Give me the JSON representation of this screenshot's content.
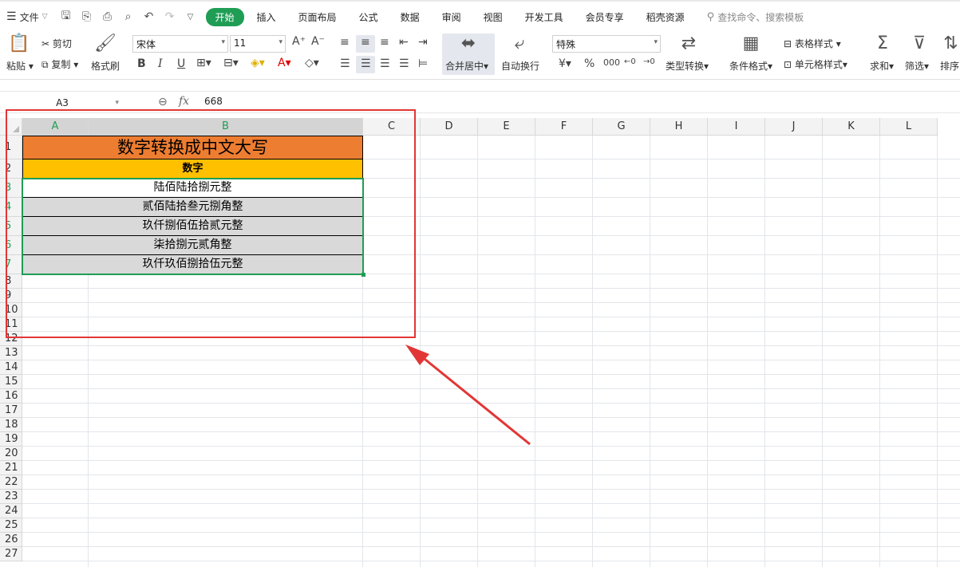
{
  "menubar": {
    "file_label": "文件",
    "tabs": [
      "开始",
      "插入",
      "页面布局",
      "公式",
      "数据",
      "审阅",
      "视图",
      "开发工具",
      "会员专享",
      "稻壳资源"
    ],
    "active_tab": "开始",
    "search_placeholder": "查找命令、搜索模板"
  },
  "ribbon": {
    "paste": "粘贴",
    "cut": "剪切",
    "copy": "复制",
    "format_painter": "格式刷",
    "font_name": "宋体",
    "font_size": "11",
    "merge_center": "合并居中",
    "wrap_text": "自动换行",
    "number_format": "特殊",
    "type_convert": "类型转换",
    "conditional_format": "条件格式",
    "table_style": "表格样式",
    "cell_style": "单元格样式",
    "sum": "求和",
    "filter": "筛选",
    "sort": "排序"
  },
  "formula": {
    "name_box": "A3",
    "value": "668"
  },
  "sheet": {
    "columns": [
      "A",
      "B",
      "C",
      "D",
      "E",
      "F",
      "G",
      "H",
      "I",
      "J",
      "K",
      "L"
    ],
    "rows": [
      "1",
      "2",
      "3",
      "4",
      "5",
      "6",
      "7",
      "8",
      "9",
      "10",
      "11",
      "12",
      "13",
      "14",
      "15",
      "16",
      "17",
      "18",
      "19",
      "20",
      "21",
      "22",
      "23",
      "24",
      "25",
      "26",
      "27"
    ],
    "title": "数字转换成中文大写",
    "header": "数字",
    "values": [
      "陆佰陆拾捌元整",
      "贰佰陆拾叁元捌角整",
      "玖仟捌佰伍拾贰元整",
      "柒拾捌元贰角整",
      "玖仟玖佰捌拾伍元整"
    ]
  },
  "colors": {
    "accent": "#1f9d55",
    "title_fill": "#ed7d31",
    "header_fill": "#ffc000",
    "data_fill": "#d9d9d9",
    "annotation": "#e23636"
  }
}
